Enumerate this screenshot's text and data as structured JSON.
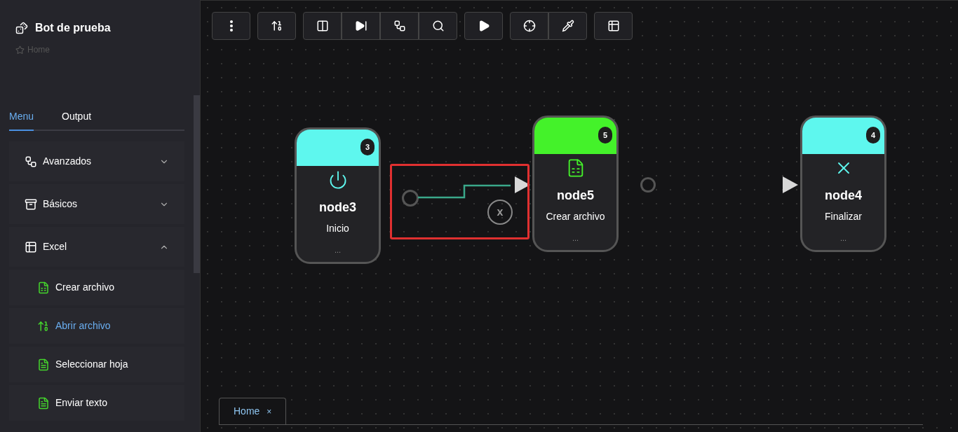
{
  "app": {
    "title": "Bot de prueba",
    "breadcrumb": "Home"
  },
  "sidebar_tabs": [
    {
      "label": "Menu",
      "selected": true
    },
    {
      "label": "Output",
      "selected": false
    }
  ],
  "menu": [
    {
      "label": "Avanzados",
      "expanded": false
    },
    {
      "label": "Básicos",
      "expanded": false
    },
    {
      "label": "Excel",
      "expanded": true,
      "children": [
        {
          "label": "Crear archivo",
          "selected": false
        },
        {
          "label": "Abrir archivo",
          "selected": true
        },
        {
          "label": "Seleccionar hoja",
          "selected": false
        },
        {
          "label": "Enviar texto",
          "selected": false
        }
      ]
    }
  ],
  "nodes": [
    {
      "name": "node3",
      "label": "Inicio",
      "badge": "3",
      "color": "#5ef7ee",
      "more": "..."
    },
    {
      "name": "node5",
      "label": "Crear archivo",
      "badge": "5",
      "color": "#44f22a",
      "more": "..."
    },
    {
      "name": "node4",
      "label": "Finalizar",
      "badge": "4",
      "color": "#5ef7ee",
      "more": "..."
    }
  ],
  "edge": {
    "selected": true,
    "delete_label": "x"
  },
  "canvas_tabs": [
    {
      "label": "Home",
      "selected": true,
      "close": "×"
    }
  ]
}
